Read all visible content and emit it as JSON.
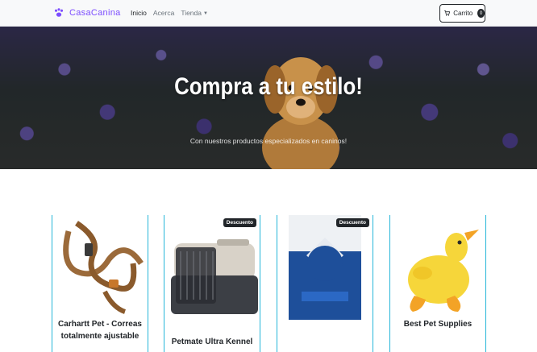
{
  "navbar": {
    "brand": "CasaCanina",
    "links": [
      "Inicio",
      "Acerca",
      "Tienda"
    ],
    "cart_label": "Carrito",
    "cart_count": "0"
  },
  "hero": {
    "title": "Compra a tu estilo!",
    "subtitle": "Con nuestros productos especializados en caninos!"
  },
  "products": [
    {
      "title": "Carhartt Pet - Correas totalmente ajustable",
      "badge": "",
      "icon": "dog-leash-image"
    },
    {
      "title": "Petmate Ultra Kennel",
      "badge": "Descuento",
      "icon": "pet-kennel-image"
    },
    {
      "title": "",
      "badge": "Descuento",
      "icon": "dog-food-bag-image"
    },
    {
      "title": "Best Pet Supplies",
      "badge": "",
      "icon": "duck-toy-image"
    }
  ],
  "colors": {
    "accent": "#26b6d9",
    "brand": "#7c4dff",
    "dark": "#212529"
  }
}
